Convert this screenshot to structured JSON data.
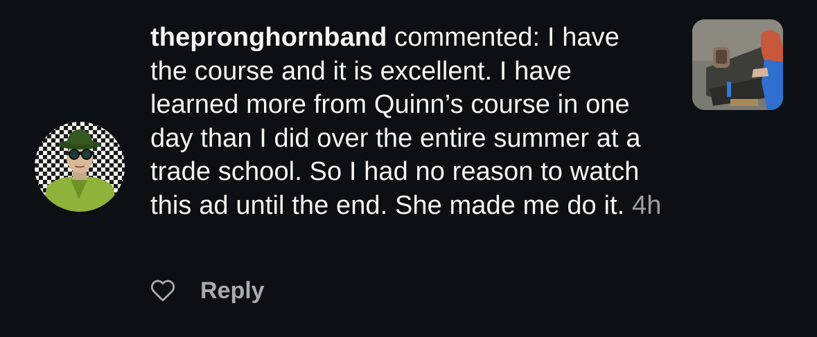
{
  "comment": {
    "username": "thepronghornband",
    "action": "commented:",
    "text": "I have the course and it is excellent. I have learned more from Quinn’s course in one day than I did over the entire summer at a trade school. So I had no reason to watch this ad until the end. She made me do it.",
    "time": "4h"
  },
  "actions": {
    "like_icon": "heart-outline-icon",
    "reply_label": "Reply"
  },
  "colors": {
    "background": "#0c1014",
    "text": "#f5f5f5",
    "muted": "#9b9fa6",
    "reply": "#a8acb2"
  }
}
